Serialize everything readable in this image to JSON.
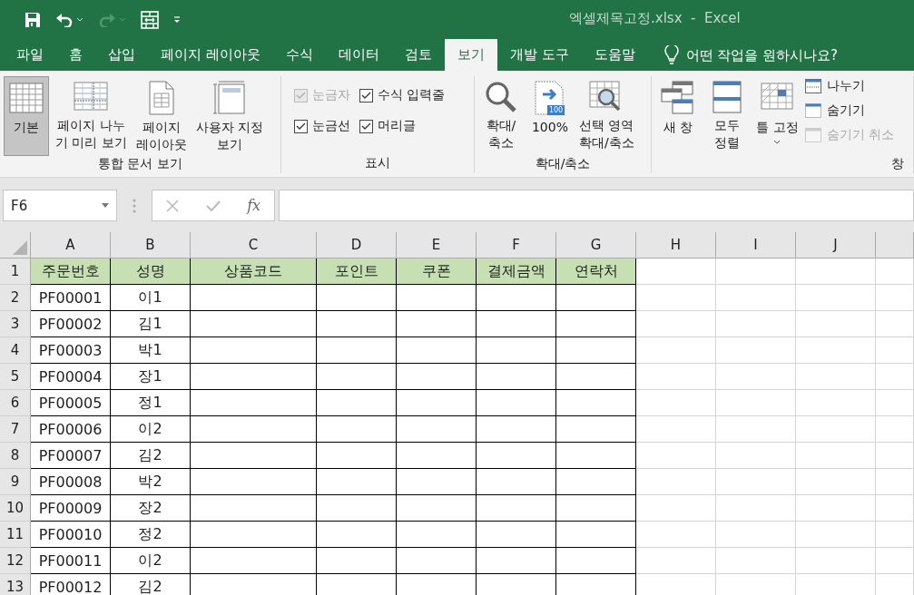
{
  "quick_access": [
    {
      "kind": "save",
      "disabled": false,
      "dropdown": false
    },
    {
      "kind": "undo",
      "disabled": false,
      "dropdown": true
    },
    {
      "kind": "redo",
      "disabled": true,
      "dropdown": true
    },
    {
      "kind": "touch",
      "disabled": false,
      "dropdown": false
    },
    {
      "kind": "customize",
      "disabled": false,
      "dropdown": false
    }
  ],
  "window": {
    "title": "엑셀제목고정.xlsx  -  Excel"
  },
  "tabs": [
    {
      "label": "파일",
      "selected": false
    },
    {
      "label": "홈",
      "selected": false
    },
    {
      "label": "삽입",
      "selected": false
    },
    {
      "label": "페이지 레이아웃",
      "selected": false
    },
    {
      "label": "수식",
      "selected": false
    },
    {
      "label": "데이터",
      "selected": false
    },
    {
      "label": "검토",
      "selected": false
    },
    {
      "label": "보기",
      "selected": true
    },
    {
      "label": "개발 도구",
      "selected": false
    },
    {
      "label": "도움말",
      "selected": false
    }
  ],
  "tell_me": {
    "placeholder": "어떤 작업을 원하시나요?"
  },
  "ribbon": {
    "groups": [
      {
        "kind": "views",
        "label": "통합 문서 보기",
        "buttons": [
          {
            "kind": "normal",
            "label": "기본",
            "selected": true
          },
          {
            "kind": "page-break",
            "label": "페이지 나누\n기 미리 보기",
            "selected": false
          },
          {
            "kind": "page-layout",
            "label": "페이지\n레이아웃",
            "selected": false
          },
          {
            "kind": "custom",
            "label": "사용자 지정\n보기",
            "selected": false
          }
        ]
      },
      {
        "kind": "show",
        "label": "표시",
        "checkboxes": [
          {
            "label": "눈금자",
            "checked": true,
            "disabled": true
          },
          {
            "label": "수식 입력줄",
            "checked": true,
            "disabled": false
          },
          {
            "label": "눈금선",
            "checked": true,
            "disabled": false
          },
          {
            "label": "머리글",
            "checked": true,
            "disabled": false
          }
        ]
      },
      {
        "kind": "zoom",
        "label": "확대/축소",
        "buttons": [
          {
            "kind": "zoom",
            "label": "확대/\n축소"
          },
          {
            "kind": "zoom100",
            "label": "100%",
            "badge": "100"
          },
          {
            "kind": "zoom-selection",
            "label": "선택 영역\n확대/축소"
          }
        ]
      },
      {
        "kind": "window",
        "label": "창",
        "buttons": [
          {
            "kind": "new-window",
            "label": "새 창"
          },
          {
            "kind": "arrange",
            "label": "모두\n정렬"
          },
          {
            "kind": "freeze",
            "label": "틀 고정",
            "dropdown": true
          }
        ],
        "small_buttons": [
          {
            "kind": "split",
            "label": "나누기",
            "disabled": false
          },
          {
            "kind": "hide",
            "label": "숨기기",
            "disabled": false
          },
          {
            "kind": "unhide",
            "label": "숨기기 취소",
            "disabled": true
          }
        ]
      }
    ]
  },
  "formula_bar": {
    "name_box": "F6",
    "function_label": "fx"
  },
  "sheet": {
    "columns": [
      "A",
      "B",
      "C",
      "D",
      "E",
      "F",
      "G",
      "H",
      "I",
      "J"
    ],
    "rows": [
      {
        "number": "1",
        "kind": "header",
        "cells": [
          "주문번호",
          "성명",
          "상품코드",
          "포인트",
          "쿠폰",
          "결제금액",
          "연락처"
        ]
      },
      {
        "number": "2",
        "kind": "data",
        "cells": [
          "PF00001",
          "이1"
        ]
      },
      {
        "number": "3",
        "kind": "data",
        "cells": [
          "PF00002",
          "김1"
        ]
      },
      {
        "number": "4",
        "kind": "data",
        "cells": [
          "PF00003",
          "박1"
        ]
      },
      {
        "number": "5",
        "kind": "data",
        "cells": [
          "PF00004",
          "장1"
        ]
      },
      {
        "number": "6",
        "kind": "data",
        "cells": [
          "PF00005",
          "정1"
        ]
      },
      {
        "number": "7",
        "kind": "data",
        "cells": [
          "PF00006",
          "이2"
        ]
      },
      {
        "number": "8",
        "kind": "data",
        "cells": [
          "PF00007",
          "김2"
        ]
      },
      {
        "number": "9",
        "kind": "data",
        "cells": [
          "PF00008",
          "박2"
        ]
      },
      {
        "number": "10",
        "kind": "data",
        "cells": [
          "PF00009",
          "장2"
        ]
      },
      {
        "number": "11",
        "kind": "data",
        "cells": [
          "PF00010",
          "정2"
        ]
      },
      {
        "number": "12",
        "kind": "data",
        "cells": [
          "PF00011",
          "이2"
        ]
      },
      {
        "number": "13",
        "kind": "data",
        "cells": [
          "PF00012",
          "김2"
        ]
      }
    ]
  }
}
